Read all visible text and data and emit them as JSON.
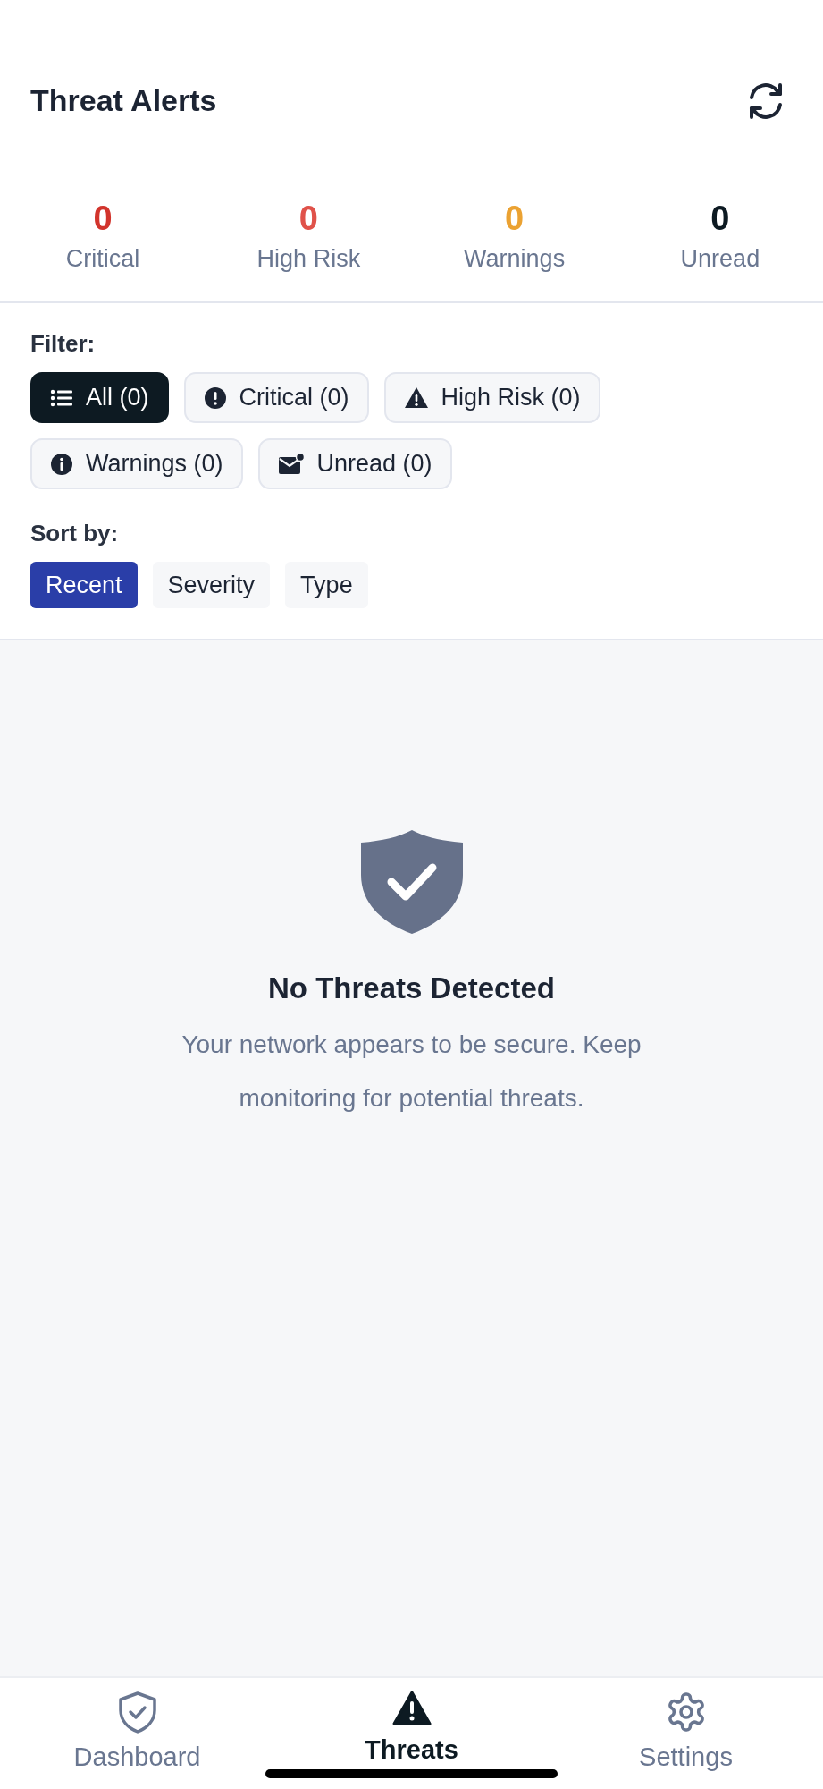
{
  "header": {
    "title": "Threat Alerts"
  },
  "stats": [
    {
      "value": "0",
      "label": "Critical",
      "color": "#d2342c"
    },
    {
      "value": "0",
      "label": "High Risk",
      "color": "#e0524a"
    },
    {
      "value": "0",
      "label": "Warnings",
      "color": "#eba232"
    },
    {
      "value": "0",
      "label": "Unread",
      "color": "#0d1a22"
    }
  ],
  "filter": {
    "label": "Filter:",
    "chips": [
      {
        "kind": "list",
        "label": "All (0)",
        "selected": true
      },
      {
        "kind": "critical",
        "label": "Critical (0)",
        "selected": false
      },
      {
        "kind": "warning",
        "label": "High Risk (0)",
        "selected": false
      },
      {
        "kind": "info",
        "label": "Warnings (0)",
        "selected": false
      },
      {
        "kind": "mail",
        "label": "Unread (0)",
        "selected": false
      }
    ]
  },
  "sort": {
    "label": "Sort by:",
    "options": [
      {
        "label": "Recent",
        "selected": true
      },
      {
        "label": "Severity",
        "selected": false
      },
      {
        "label": "Type",
        "selected": false
      }
    ]
  },
  "empty_state": {
    "title": "No Threats Detected",
    "message": "Your network appears to be secure. Keep monitoring for potential threats."
  },
  "tab_bar": [
    {
      "kind": "shield",
      "label": "Dashboard",
      "selected": false
    },
    {
      "kind": "alert",
      "label": "Threats",
      "selected": true
    },
    {
      "kind": "gear",
      "label": "Settings",
      "selected": false
    }
  ]
}
